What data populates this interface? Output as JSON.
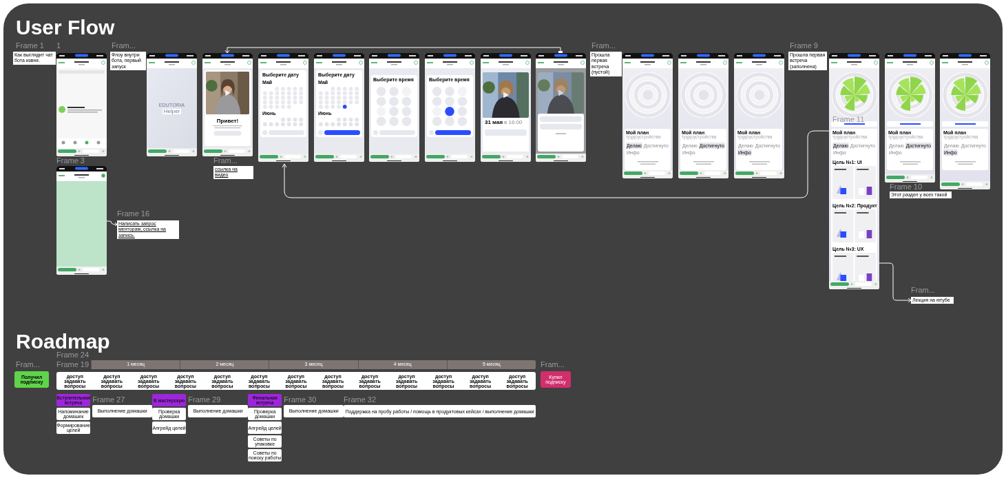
{
  "sections": [
    {
      "title": "User Flow"
    },
    {
      "title": "Roadmap"
    }
  ],
  "canvas_labels": [
    "Frame 1",
    "1",
    "Fram...",
    "Fram...",
    "Frame 9",
    "Frame 3",
    "Fram...",
    "Frame 16",
    "Frame 11",
    "Frame 10",
    "Fram..."
  ],
  "notes": [
    {
      "text": "Как выглядит чат бота извне.",
      "link": false
    },
    {
      "text": "Флоу внутри бота, первый запуск",
      "link": false
    },
    {
      "text": "ссылка на видео",
      "link": true
    },
    {
      "text": "Прошла первая встреча (пустой)",
      "link": false
    },
    {
      "text": "Прошла первая встреча (заполнена)",
      "link": false
    },
    {
      "text": "Написать запрос менторам, ссылка на запись.",
      "link": true
    },
    {
      "text": "Этот раздел у всех такой",
      "link": false
    },
    {
      "text": "Лекция на ютубе",
      "link": false
    }
  ],
  "phones": [
    {
      "kind": "chatlist"
    },
    {
      "kind": "splash",
      "logo": "EDUTORIA",
      "badge": "Helper"
    },
    {
      "kind": "hello",
      "title": "Привет!"
    },
    {
      "kind": "date",
      "title": "Выберите дату",
      "months": [
        "Май",
        "Июнь"
      ],
      "date_selected": false
    },
    {
      "kind": "date",
      "title": "Выберите дату",
      "months": [
        "Май",
        "Июнь"
      ],
      "date_selected": true
    },
    {
      "kind": "time",
      "title": "Выберите время",
      "time_selected": false
    },
    {
      "kind": "time",
      "title": "Выберите время",
      "time_selected": true
    },
    {
      "kind": "booked",
      "date": "31 мая",
      "time": "в 16:00"
    },
    {
      "kind": "sheet"
    },
    {
      "kind": "plan",
      "title": "Мой план",
      "subtitle": "трудоустройства",
      "filled": false,
      "tabs": [
        {
          "label": "Делаю",
          "selected": true
        },
        {
          "label": "Достигнуто",
          "selected": false
        },
        {
          "label": "Инфо",
          "selected": false
        }
      ]
    },
    {
      "kind": "plan",
      "title": "Мой план",
      "subtitle": "трудоустройства",
      "filled": false,
      "tabs": [
        {
          "label": "Делаю",
          "selected": false
        },
        {
          "label": "Достигнуто",
          "selected": true
        },
        {
          "label": "Инфо",
          "selected": false
        }
      ]
    },
    {
      "kind": "plan",
      "title": "Мой план",
      "subtitle": "трудоустройства",
      "filled": false,
      "tabs": [
        {
          "label": "Делаю",
          "selected": false
        },
        {
          "label": "Достигнуто",
          "selected": false
        },
        {
          "label": "Инфо",
          "selected": true
        }
      ]
    },
    {
      "kind": "plan",
      "title": "Мой план",
      "subtitle": "трудоустройства",
      "filled": true,
      "tabs": [
        {
          "label": "Делаю",
          "selected": true
        },
        {
          "label": "Достигнуто",
          "selected": false
        },
        {
          "label": "Инфо",
          "selected": false
        }
      ],
      "goals": [
        "Цель №1: UI",
        "Цель №2: Продукт",
        "Цель №3: UX"
      ]
    },
    {
      "kind": "plan",
      "title": "Мой план",
      "subtitle": "трудоустройства",
      "filled": true,
      "tabs": [
        {
          "label": "Делаю",
          "selected": false
        },
        {
          "label": "Достигнуто",
          "selected": true
        },
        {
          "label": "Инфо",
          "selected": false
        }
      ]
    },
    {
      "kind": "plan",
      "title": "Мой план",
      "subtitle": "трудоустройства",
      "filled": true,
      "tabs": [
        {
          "label": "Делаю",
          "selected": false
        },
        {
          "label": "Достигнуто",
          "selected": false
        },
        {
          "label": "Инфо",
          "selected": true
        }
      ]
    },
    {
      "kind": "blank"
    }
  ],
  "roadmap": {
    "labels": [
      "Frame 24",
      "Fram...",
      "Frame 19",
      "Fram..."
    ],
    "months": [
      "1 месяц",
      "2 месяц",
      "3 месяц",
      "4 месяц",
      "5 месяц"
    ],
    "access": [
      "доступ задавать вопросы",
      "доступ задавать вопросы",
      "доступ задавать вопросы",
      "доступ задавать вопросы",
      "доступ задавать вопросы",
      "доступ задавать вопросы",
      "доступ задавать вопросы",
      "доступ задавать вопросы",
      "доступ задавать вопросы",
      "доступ задавать вопросы",
      "доступ задавать вопросы",
      "доступ задавать вопросы",
      "доступ задавать вопросы"
    ],
    "start": "Получил подписку",
    "end": "Купил подписку",
    "stages": [
      {
        "title": "Вступительная встреча",
        "items": [
          "Напоминание домашек",
          "Формирование целей"
        ],
        "task_label": "Frame 27",
        "task": "Выполнение домашки"
      },
      {
        "title": "В мастерскую",
        "items": [
          "Проверка домашки",
          "Апгрейд целей"
        ],
        "task_label": "Frame 29",
        "task": "Выполнение домашки"
      },
      {
        "title": "Финальная встреча",
        "items": [
          "Проверка домашки",
          "Апгрейд целей",
          "Советы по упаковке",
          "Советы по поиску работы"
        ],
        "task_label": "Frame 30",
        "task": "Выполнение домашки"
      }
    ],
    "support": {
      "label": "Frame 32",
      "text": "Поддержка на пробу работы / помощь в продуктовых кейсах / выполнение домашки"
    }
  }
}
